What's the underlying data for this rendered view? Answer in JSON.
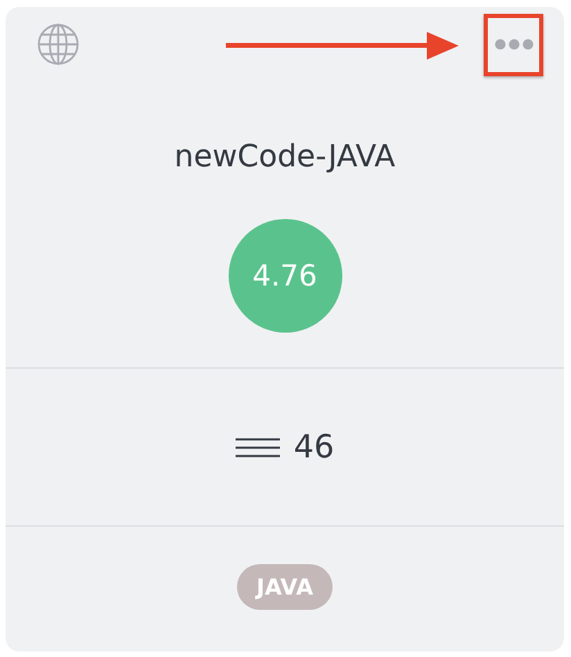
{
  "card": {
    "title": "newCode-JAVA",
    "score": "4.76",
    "count": "46",
    "tags": [
      {
        "label": "JAVA",
        "color": "#c4b8b9"
      }
    ],
    "annotation": {
      "highlighted": true
    }
  }
}
